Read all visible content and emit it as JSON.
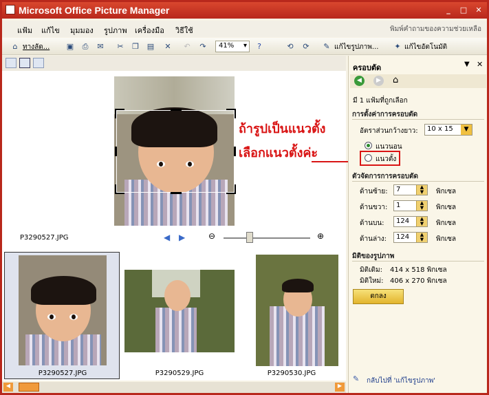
{
  "app": {
    "title": "Microsoft Office Picture Manager",
    "controls": {
      "minimize": "_",
      "maximize": "□",
      "close": "✕"
    }
  },
  "menu": {
    "items": [
      "แฟ้ม",
      "แก้ไข",
      "มุมมอง",
      "รูปภาพ",
      "เครื่องมือ",
      "วิธีใช้"
    ],
    "help_prompt": "พิมพ์คำถามของความช่วยเหลือ"
  },
  "toolbar": {
    "shortcuts_label": "ทางลัด...",
    "zoom": "41%",
    "edit_picture_label": "แก้ไขรูปภาพ...",
    "auto_correct_label": "แก้ไขอัตโนมัติ"
  },
  "main": {
    "filename": "P3290527.JPG",
    "annotation": {
      "line1": "ถ้ารูปเป็นแนวตั้ง",
      "line2": "เลือกแนวตั้งค่ะ"
    }
  },
  "thumbnails": [
    {
      "name": "P3290527.JPG",
      "selected": true
    },
    {
      "name": "P3290529.JPG",
      "selected": false
    },
    {
      "name": "P3290530.JPG",
      "selected": false
    }
  ],
  "panel": {
    "title": "ครอบตัด",
    "selection_count": "มี 1 แฟ้มที่ถูกเลือก",
    "crop_settings": {
      "title": "การตั้งค่าการครอบตัด",
      "aspect_label": "อัตราส่วนกว้างยาว:",
      "aspect_value": "10 x 15",
      "landscape_label": "แนวนอน",
      "portrait_label": "แนวตั้ง",
      "selected_orientation": "landscape"
    },
    "crop_handles": {
      "title": "ตัวจัดการการครอบตัด",
      "unit": "พิกเซล",
      "left_label": "ด้านซ้าย:",
      "left_value": "7",
      "right_label": "ด้านขวา:",
      "right_value": "1",
      "top_label": "ด้านบน:",
      "top_value": "124",
      "bottom_label": "ด้านล่าง:",
      "bottom_value": "124"
    },
    "dimensions": {
      "title": "มิติของรูปภาพ",
      "original_label": "มิติเดิม:",
      "original_value": "414 x 518 พิกเซล",
      "new_label": "มิติใหม่:",
      "new_value": "406 x 270 พิกเซล"
    },
    "ok_label": "ตกลง",
    "back_link": "กลับไปที่ 'แก้ไขรูปภาพ'"
  },
  "colors": {
    "titlebar": "#b8281c",
    "annotation": "#d91414",
    "ok_button": "#e3b42c"
  }
}
